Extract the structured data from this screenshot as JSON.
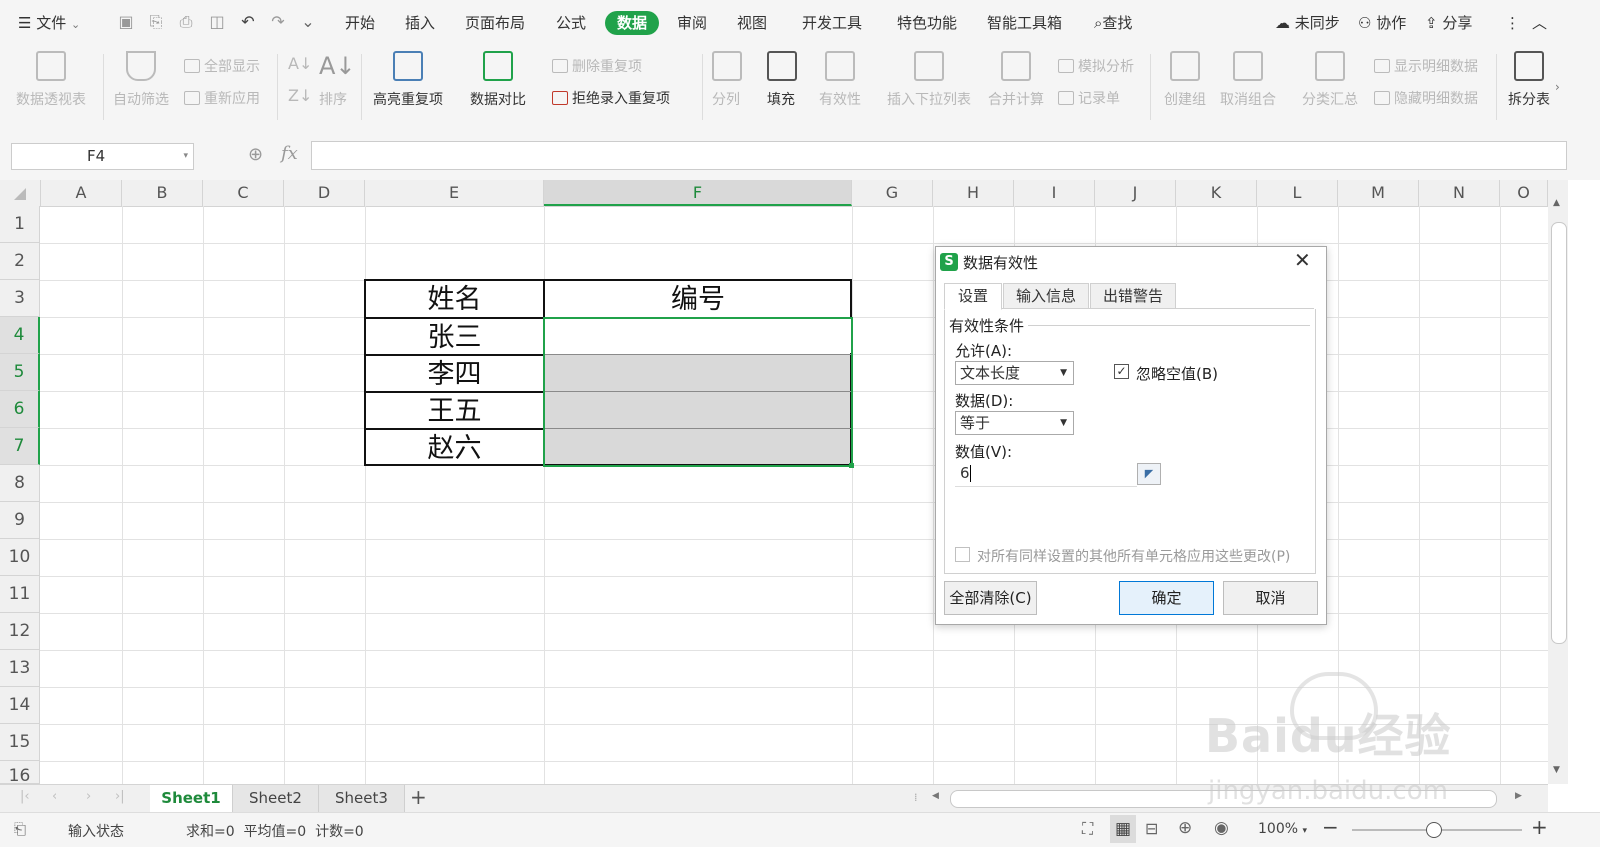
{
  "menubar": {
    "file_label": "文件",
    "items": [
      "开始",
      "插入",
      "页面布局",
      "公式",
      "数据",
      "审阅",
      "视图",
      "开发工具",
      "特色功能",
      "智能工具箱"
    ],
    "active_item": "数据",
    "search_label": "查找",
    "sync_label": "未同步",
    "collab_label": "协作",
    "share_label": "分享"
  },
  "ribbon": {
    "pivot": "数据透视表",
    "autofilter": "自动筛选",
    "show_all": "全部显示",
    "reapply": "重新应用",
    "sort": "排序",
    "highlight_dup": "高亮重复项",
    "data_compare": "数据对比",
    "remove_dup": "删除重复项",
    "reject_dup": "拒绝录入重复项",
    "split": "分列",
    "fill": "填充",
    "validity": "有效性",
    "insert_dropdown": "插入下拉列表",
    "consolidate": "合并计算",
    "simulate": "模拟分析",
    "record": "记录单",
    "group": "创建组",
    "ungroup": "取消组合",
    "subtotal": "分类汇总",
    "show_detail": "显示明细数据",
    "hide_detail": "隐藏明细数据",
    "split_table": "拆分表"
  },
  "formula_bar": {
    "cell_ref": "F4",
    "fx_label": "fx",
    "value": ""
  },
  "grid": {
    "columns": [
      "A",
      "B",
      "C",
      "D",
      "E",
      "F",
      "G",
      "H",
      "I",
      "J",
      "K",
      "L",
      "M",
      "N",
      "O"
    ],
    "selected_column": "F",
    "rows": [
      "1",
      "2",
      "3",
      "4",
      "5",
      "6",
      "7",
      "8",
      "9",
      "10",
      "11",
      "12",
      "13",
      "14",
      "15",
      "16"
    ],
    "table": {
      "header": [
        "姓名",
        "编号"
      ],
      "names": [
        "张三",
        "李四",
        "王五",
        "赵六"
      ]
    }
  },
  "dialog": {
    "title": "数据有效性",
    "tabs": [
      "设置",
      "输入信息",
      "出错警告"
    ],
    "section": "有效性条件",
    "allow_label": "允许(A):",
    "allow_value": "文本长度",
    "ignore_blank_label": "忽略空值(B)",
    "ignore_blank_checked": true,
    "data_label": "数据(D):",
    "data_value": "等于",
    "value_label": "数值(V):",
    "value_input": "6",
    "apply_all_label": "对所有同样设置的其他所有单元格应用这些更改(P)",
    "clear_all": "全部清除(C)",
    "ok": "确定",
    "cancel": "取消"
  },
  "sheets": [
    "Sheet1",
    "Sheet2",
    "Sheet3"
  ],
  "active_sheet": "Sheet1",
  "status": {
    "mode": "输入状态",
    "stats": "求和=0  平均值=0  计数=0",
    "zoom": "100%"
  },
  "watermark": "Baidu经验 jingyan.baidu.com",
  "colors": {
    "accent_green": "#20a24a",
    "selection_fill": "#d9d9d9"
  }
}
